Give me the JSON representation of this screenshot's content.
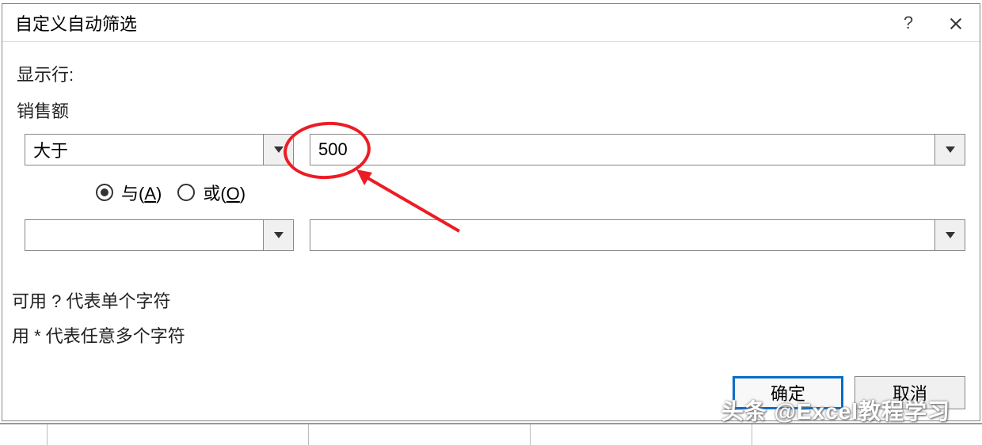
{
  "dialog": {
    "title": "自定义自动筛选",
    "show_rows_label": "显示行:",
    "field_label": "销售额",
    "criteria1": {
      "operator": "大于",
      "value": "500"
    },
    "logic": {
      "and_label": "与(A)",
      "or_label": "或(O)",
      "selected": "and"
    },
    "criteria2": {
      "operator": "",
      "value": ""
    },
    "hint1": "可用 ? 代表单个字符",
    "hint2": "用 * 代表任意多个字符",
    "ok_label": "确定",
    "cancel_label": "取消",
    "help_symbol": "?"
  },
  "watermark": "头条 @Excel教程学习"
}
